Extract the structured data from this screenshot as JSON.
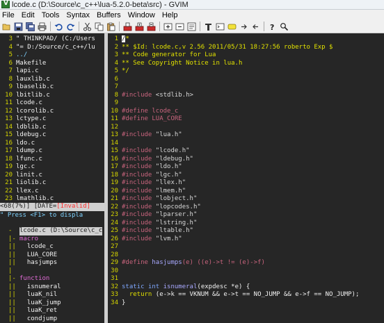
{
  "window": {
    "title": "lcode.c (D:\\Source\\c_c++\\lua-5.2.0-beta\\src) - GVIM"
  },
  "menu": [
    "File",
    "Edit",
    "Tools",
    "Syntax",
    "Buffers",
    "Window",
    "Help"
  ],
  "toolbar_icons": [
    "open-icon",
    "save-icon",
    "save-all-icon",
    "print-icon",
    "undo-icon",
    "redo-icon",
    "cut-icon",
    "copy-icon",
    "paste-icon",
    "find-replace-icon",
    "find-next-icon",
    "find-prev-icon",
    "load-session-icon",
    "save-session-icon",
    "run-script-icon",
    "make-icon",
    "shell-icon",
    "run-ctags-icon",
    "tag-jump-icon",
    "tag-back-icon",
    "help-icon",
    "find-help-icon"
  ],
  "explorer": {
    "header_lines": [
      {
        "num": "3",
        "text": "\" THINKPAD/ (C:/Users"
      },
      {
        "num": "4",
        "text": "\"= D:/Source/c_c++/lu"
      }
    ],
    "updir": {
      "num": "5",
      "text": "../"
    },
    "files": [
      {
        "num": "6",
        "text": "Makefile"
      },
      {
        "num": "7",
        "text": "lapi.c"
      },
      {
        "num": "8",
        "text": "lauxlib.c"
      },
      {
        "num": "9",
        "text": "lbaselib.c"
      },
      {
        "num": "10",
        "text": "lbitlib.c"
      },
      {
        "num": "11",
        "text": "lcode.c"
      },
      {
        "num": "12",
        "text": "lcorolib.c"
      },
      {
        "num": "13",
        "text": "lctype.c"
      },
      {
        "num": "14",
        "text": "ldblib.c"
      },
      {
        "num": "15",
        "text": "ldebug.c"
      },
      {
        "num": "16",
        "text": "ldo.c"
      },
      {
        "num": "17",
        "text": "ldump.c"
      },
      {
        "num": "18",
        "text": "lfunc.c"
      },
      {
        "num": "19",
        "text": "lgc.c"
      },
      {
        "num": "20",
        "text": "linit.c"
      },
      {
        "num": "21",
        "text": "liolib.c"
      },
      {
        "num": "22",
        "text": "llex.c"
      },
      {
        "num": "23",
        "text": "lmathlib.c"
      }
    ],
    "status_prefix": "<68(7%)] [DATE=",
    "status_invalid": "[Invalid]",
    "cmdline": "\" Press <F1> to displa"
  },
  "taglist": {
    "header": "lcode.c (D:\\Source\\c_c",
    "groups": [
      {
        "fold": "-",
        "kind": "macro",
        "items": [
          "lcode_c",
          "LUA_CORE",
          "hasjumps"
        ]
      },
      {
        "fold": "-",
        "kind": "function",
        "items": [
          "isnumeral",
          "luaK_nil",
          "luaK_jump",
          "luaK_ret",
          "condjump"
        ]
      }
    ]
  },
  "code": {
    "cursor_char": "/",
    "lines": [
      {
        "num": "1",
        "parts": [
          [
            "*",
            "c-comment"
          ]
        ],
        "cursor": true
      },
      {
        "num": "2",
        "parts": [
          [
            "** $Id: lcode.c,v 2.56 2011/05/31 18:27:56 roberto Exp $",
            "c-comment"
          ]
        ]
      },
      {
        "num": "3",
        "parts": [
          [
            "** Code generator for Lua",
            "c-comment"
          ]
        ]
      },
      {
        "num": "4",
        "parts": [
          [
            "** See Copyright Notice in lua.h",
            "c-comment"
          ]
        ]
      },
      {
        "num": "5",
        "parts": [
          [
            "*/",
            "c-comment"
          ]
        ]
      },
      {
        "num": "6",
        "parts": []
      },
      {
        "num": "7",
        "parts": []
      },
      {
        "num": "8",
        "parts": [
          [
            "#include ",
            "c-pre"
          ],
          [
            "<stdlib.h>",
            "c-str"
          ]
        ]
      },
      {
        "num": "9",
        "parts": []
      },
      {
        "num": "10",
        "parts": [
          [
            "#define ",
            "c-pre"
          ],
          [
            "lcode_c",
            "c-id"
          ]
        ]
      },
      {
        "num": "11",
        "parts": [
          [
            "#define ",
            "c-pre"
          ],
          [
            "LUA_CORE",
            "c-id"
          ]
        ]
      },
      {
        "num": "12",
        "parts": []
      },
      {
        "num": "13",
        "parts": [
          [
            "#include ",
            "c-pre"
          ],
          [
            "\"lua.h\"",
            "c-str"
          ]
        ]
      },
      {
        "num": "14",
        "parts": []
      },
      {
        "num": "15",
        "parts": [
          [
            "#include ",
            "c-pre"
          ],
          [
            "\"lcode.h\"",
            "c-str"
          ]
        ]
      },
      {
        "num": "16",
        "parts": [
          [
            "#include ",
            "c-pre"
          ],
          [
            "\"ldebug.h\"",
            "c-str"
          ]
        ]
      },
      {
        "num": "17",
        "parts": [
          [
            "#include ",
            "c-pre"
          ],
          [
            "\"ldo.h\"",
            "c-str"
          ]
        ]
      },
      {
        "num": "18",
        "parts": [
          [
            "#include ",
            "c-pre"
          ],
          [
            "\"lgc.h\"",
            "c-str"
          ]
        ]
      },
      {
        "num": "19",
        "parts": [
          [
            "#include ",
            "c-pre"
          ],
          [
            "\"llex.h\"",
            "c-str"
          ]
        ]
      },
      {
        "num": "20",
        "parts": [
          [
            "#include ",
            "c-pre"
          ],
          [
            "\"lmem.h\"",
            "c-str"
          ]
        ]
      },
      {
        "num": "21",
        "parts": [
          [
            "#include ",
            "c-pre"
          ],
          [
            "\"lobject.h\"",
            "c-str"
          ]
        ]
      },
      {
        "num": "22",
        "parts": [
          [
            "#include ",
            "c-pre"
          ],
          [
            "\"lopcodes.h\"",
            "c-str"
          ]
        ]
      },
      {
        "num": "23",
        "parts": [
          [
            "#include ",
            "c-pre"
          ],
          [
            "\"lparser.h\"",
            "c-str"
          ]
        ]
      },
      {
        "num": "24",
        "parts": [
          [
            "#include ",
            "c-pre"
          ],
          [
            "\"lstring.h\"",
            "c-str"
          ]
        ]
      },
      {
        "num": "25",
        "parts": [
          [
            "#include ",
            "c-pre"
          ],
          [
            "\"ltable.h\"",
            "c-str"
          ]
        ]
      },
      {
        "num": "26",
        "parts": [
          [
            "#include ",
            "c-pre"
          ],
          [
            "\"lvm.h\"",
            "c-str"
          ]
        ]
      },
      {
        "num": "27",
        "parts": []
      },
      {
        "num": "28",
        "parts": []
      },
      {
        "num": "29",
        "parts": [
          [
            "#define ",
            "c-pre"
          ],
          [
            "hasjumps",
            "c-fn"
          ],
          [
            "(e) ((e)->t != (e)->f)",
            "c-pre"
          ]
        ]
      },
      {
        "num": "30",
        "parts": []
      },
      {
        "num": "31",
        "parts": []
      },
      {
        "num": "32",
        "parts": [
          [
            "static ",
            "c-type"
          ],
          [
            "int ",
            "c-type"
          ],
          [
            "isnumeral",
            "c-fn"
          ],
          [
            "(expdesc *e) {",
            "c-norm"
          ]
        ]
      },
      {
        "num": "33",
        "parts": [
          [
            "  ",
            "c-norm"
          ],
          [
            "return ",
            "c-kw"
          ],
          [
            "(e->k == VKNUM && e->t == NO_JUMP && e->f == NO_JUMP);",
            "c-norm"
          ]
        ]
      },
      {
        "num": "34",
        "parts": [
          [
            "}",
            "c-norm"
          ]
        ]
      }
    ]
  }
}
